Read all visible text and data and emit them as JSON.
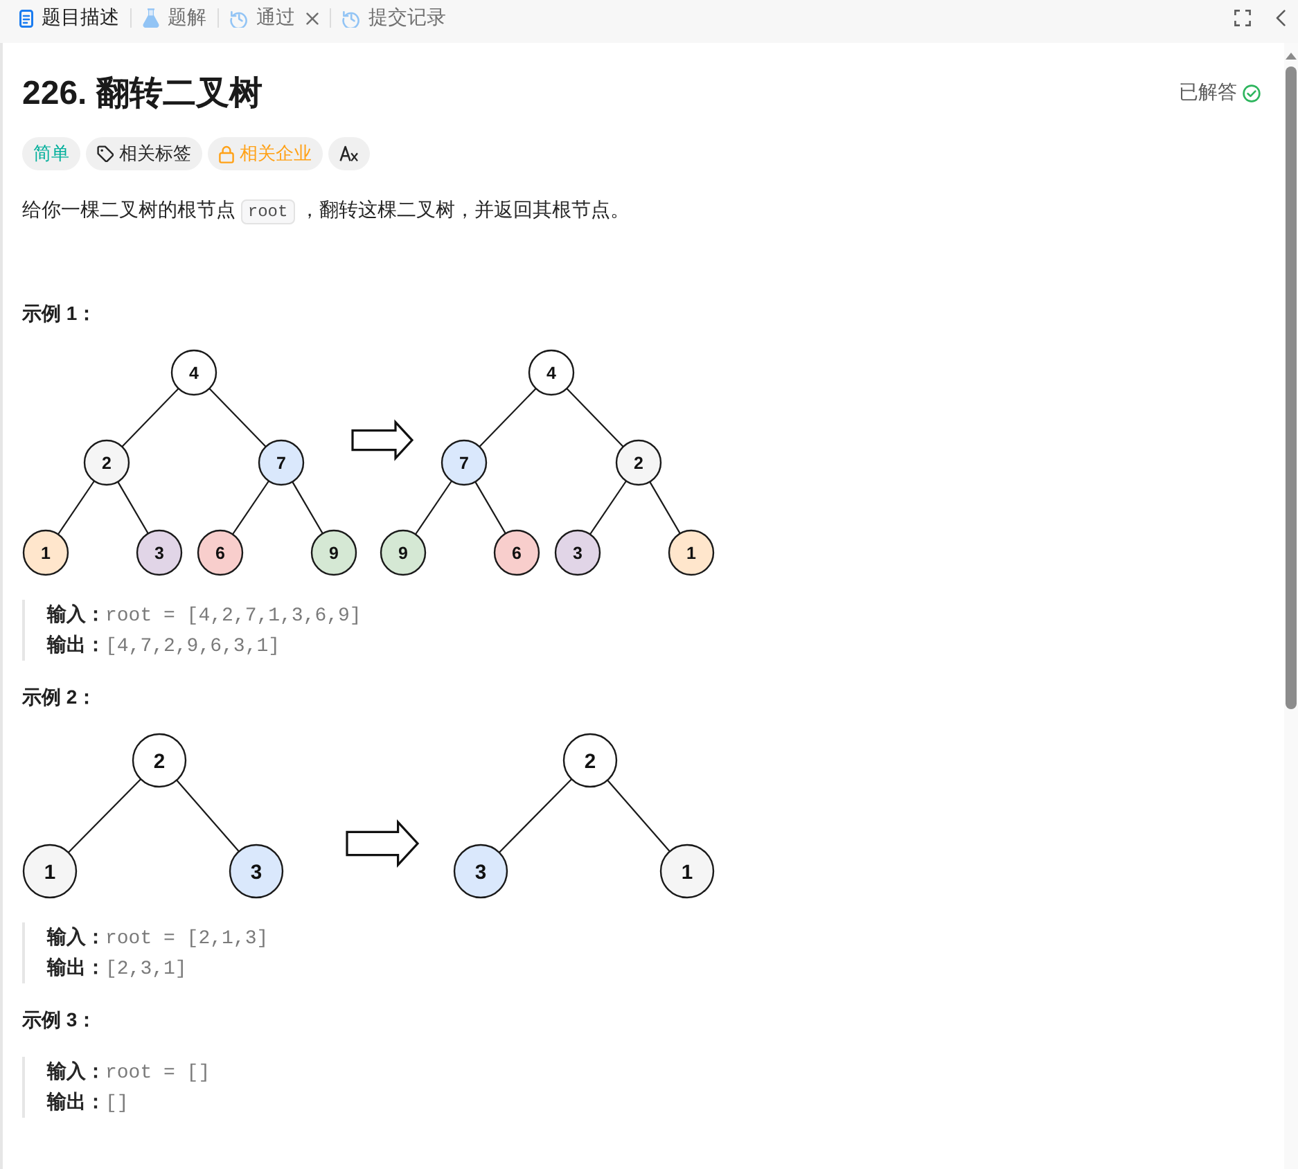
{
  "tabs": [
    {
      "label": "题目描述",
      "kind": "description",
      "selected": true,
      "closable": false
    },
    {
      "label": "题解",
      "kind": "solutions",
      "selected": false,
      "closable": false
    },
    {
      "label": "通过",
      "kind": "result",
      "selected": false,
      "closable": true
    },
    {
      "label": "提交记录",
      "kind": "submissions",
      "selected": false,
      "closable": false
    }
  ],
  "problem": {
    "title": "226. 翻转二叉树",
    "status": "已解答",
    "solved": true
  },
  "tags": [
    {
      "kind": "difficulty",
      "label": "简单"
    },
    {
      "kind": "topics",
      "label": "相关标签"
    },
    {
      "kind": "companies",
      "label": "相关企业"
    },
    {
      "kind": "translate"
    }
  ],
  "description": [
    {
      "kind": "text",
      "text": "给你一棵二叉树的根节点 "
    },
    {
      "kind": "code",
      "text": "root"
    },
    {
      "kind": "text",
      "text": " ，翻转这棵二叉树，并返回其根节点。"
    }
  ],
  "examples": [
    {
      "title": "示例 1：",
      "figure": {
        "before": {
          "value": "4",
          "children": [
            {
              "value": "2",
              "color": "#f5f5f5",
              "children": [
                {
                  "value": "1",
                  "color": "#ffe6cc"
                },
                {
                  "value": "3",
                  "color": "#e1d5e7"
                }
              ]
            },
            {
              "value": "7",
              "color": "#dae8fc",
              "children": [
                {
                  "value": "6",
                  "color": "#f8cecc"
                },
                {
                  "value": "9",
                  "color": "#d5e8d4"
                }
              ]
            }
          ]
        },
        "after": {
          "value": "4",
          "children": [
            {
              "value": "7",
              "color": "#dae8fc",
              "children": [
                {
                  "value": "9",
                  "color": "#d5e8d4"
                },
                {
                  "value": "6",
                  "color": "#f8cecc"
                }
              ]
            },
            {
              "value": "2",
              "color": "#f5f5f5",
              "children": [
                {
                  "value": "3",
                  "color": "#e1d5e7"
                },
                {
                  "value": "1",
                  "color": "#ffe6cc"
                }
              ]
            }
          ]
        }
      },
      "input_label": "输入：",
      "input": "root = [4,2,7,1,3,6,9]",
      "output_label": "输出：",
      "output": "[4,7,2,9,6,3,1]"
    },
    {
      "title": "示例 2：",
      "figure": {
        "before": {
          "value": "2",
          "children": [
            {
              "value": "1",
              "color": "#f5f5f5"
            },
            {
              "value": "3",
              "color": "#dae8fc"
            }
          ]
        },
        "after": {
          "value": "2",
          "children": [
            {
              "value": "3",
              "color": "#dae8fc"
            },
            {
              "value": "1",
              "color": "#f5f5f5"
            }
          ]
        }
      },
      "input_label": "输入：",
      "input": "root = [2,1,3]",
      "output_label": "输出：",
      "output": "[2,3,1]"
    },
    {
      "title": "示例 3：",
      "input_label": "输入：",
      "input": "root = []",
      "output_label": "输出：",
      "output": "[]"
    }
  ]
}
